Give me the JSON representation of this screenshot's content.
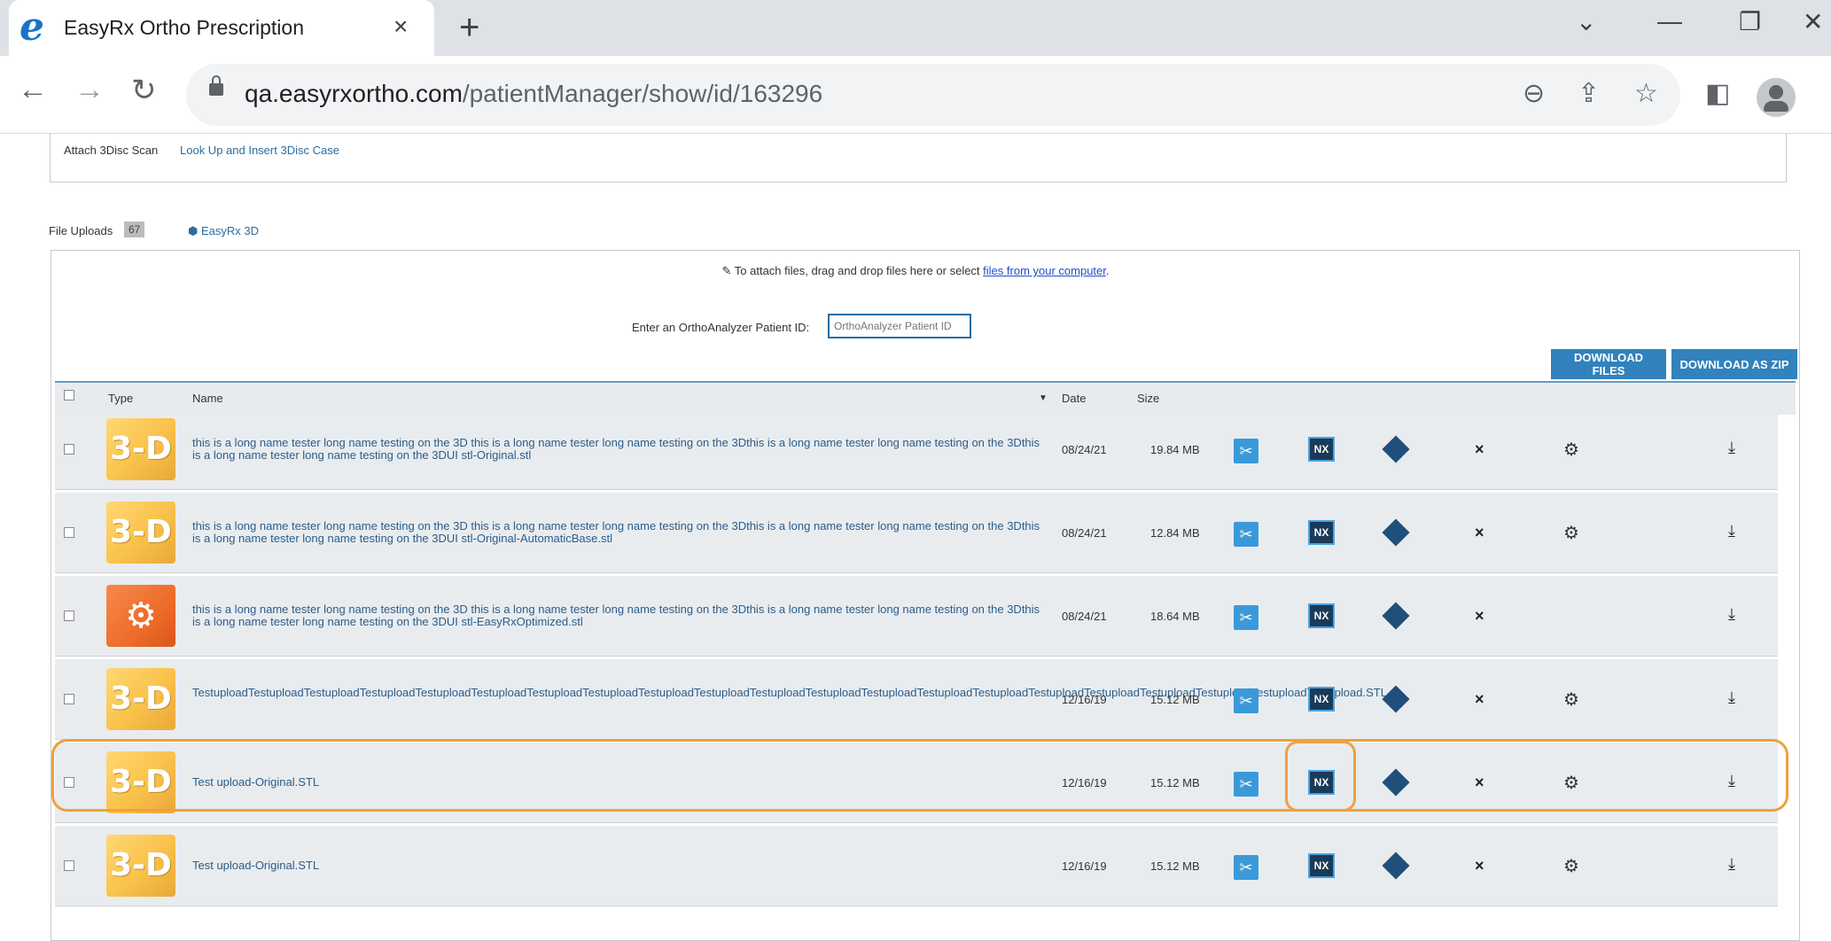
{
  "browser": {
    "tab_title": "EasyRx Ortho Prescription",
    "tab_close": "×",
    "new_tab": "+",
    "url_host": "qa.easyrxortho.com",
    "url_path": "/patientManager/show/id/163296",
    "icons": [
      "edge-logo-icon",
      "back-icon",
      "forward-icon",
      "reload-icon",
      "lock-icon",
      "zoom-out-icon",
      "share-icon",
      "star-icon",
      "sidebar-icon",
      "profile-icon",
      "minimize-icon",
      "restore-icon",
      "close-window-icon"
    ]
  },
  "top_links": {
    "attach": "Attach 3Disc Scan",
    "lookup": "Look Up and Insert 3Disc Case"
  },
  "file_tabs": {
    "uploads_label": "File Uploads",
    "uploads_count": "67",
    "easyrx3d_label": "EasyRx 3D"
  },
  "attach_hint": {
    "prefix": "To attach files, drag and drop files here or select ",
    "link": "files from your computer",
    "suffix": "."
  },
  "orthoanalyzer": {
    "label": "Enter an OrthoAnalyzer Patient ID:",
    "placeholder": "OrthoAnalyzer Patient ID"
  },
  "buttons": {
    "download_files": "DOWNLOAD FILES",
    "download_zip": "DOWNLOAD AS ZIP"
  },
  "table": {
    "headers": {
      "type": "Type",
      "name": "Name",
      "date": "Date",
      "size": "Size"
    },
    "rows": [
      {
        "thumb": "3-D",
        "kind": "3d",
        "name": "this is a long name tester long name testing on the 3D this is a long name tester long name testing on the 3Dthis is a long name tester long name testing on the 3Dthis is a long name tester long name testing on the 3DUI stl-Original.stl",
        "date": "08/24/21",
        "size": "19.84 MB",
        "gear": true
      },
      {
        "thumb": "3-D",
        "kind": "3d",
        "name": "this is a long name tester long name testing on the 3D this is a long name tester long name testing on the 3Dthis is a long name tester long name testing on the 3Dthis is a long name tester long name testing on the 3DUI stl-Original-AutomaticBase.stl",
        "date": "08/24/21",
        "size": "12.84 MB",
        "gear": true
      },
      {
        "thumb": "⚙",
        "kind": "gear",
        "name": "this is a long name tester long name testing on the 3D this is a long name tester long name testing on the 3Dthis is a long name tester long name testing on the 3Dthis is a long name tester long name testing on the 3DUI stl-EasyRxOptimized.stl",
        "date": "08/24/21",
        "size": "18.64 MB",
        "gear": false
      },
      {
        "thumb": "3-D",
        "kind": "3d",
        "name": "TestuploadTestuploadTestuploadTestuploadTestuploadTestuploadTestuploadTestuploadTestuploadTestuploadTestuploadTestuploadTestuploadTestuploadTestuploadTestuploadTestuploadTestuploadTestuploadTestuploadTestupload.STL",
        "date": "12/16/19",
        "size": "15.12 MB",
        "gear": true
      },
      {
        "thumb": "3-D",
        "kind": "3d",
        "name": "Test upload-Original.STL",
        "date": "12/16/19",
        "size": "15.12 MB",
        "gear": true
      },
      {
        "thumb": "3-D",
        "kind": "3d",
        "name": "Test upload-Original.STL",
        "date": "12/16/19",
        "size": "15.12 MB",
        "gear": true
      }
    ],
    "action_labels": {
      "nx": "NX",
      "delete": "×",
      "download": "⤓",
      "settings": "⚙"
    }
  },
  "highlight_color": "#f0a040"
}
